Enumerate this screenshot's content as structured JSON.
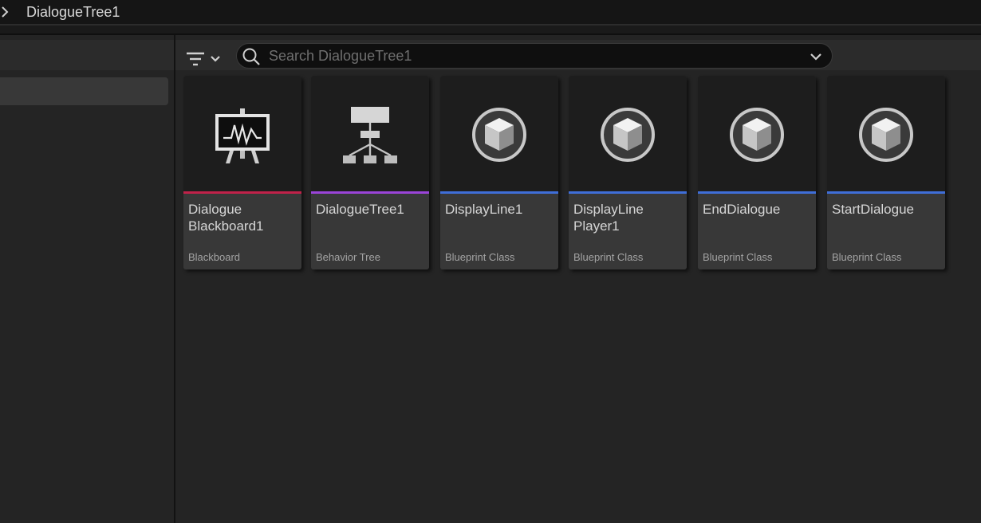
{
  "breadcrumb": {
    "path": "DialogueTree1"
  },
  "search": {
    "placeholder": "Search DialogueTree1"
  },
  "colors": {
    "blackboard": "#c0224a",
    "behavior_tree": "#9a44d8",
    "blueprint": "#3f6ed8"
  },
  "assets": [
    {
      "name": "Dialogue Blackboard1",
      "line1": "Dialogue",
      "line2": "Blackboard1",
      "type": "Blackboard",
      "icon": "blackboard-icon",
      "color": "#c0224a"
    },
    {
      "name": "DialogueTree1",
      "line1": "DialogueTree1",
      "line2": "",
      "type": "Behavior Tree",
      "icon": "behavior-tree-icon",
      "color": "#9a44d8"
    },
    {
      "name": "DisplayLine1",
      "line1": "DisplayLine1",
      "line2": "",
      "type": "Blueprint Class",
      "icon": "blueprint-cube-icon",
      "color": "#3f6ed8"
    },
    {
      "name": "DisplayLine Player1",
      "line1": "DisplayLine",
      "line2": "Player1",
      "type": "Blueprint Class",
      "icon": "blueprint-cube-icon",
      "color": "#3f6ed8"
    },
    {
      "name": "EndDialogue",
      "line1": "EndDialogue",
      "line2": "",
      "type": "Blueprint Class",
      "icon": "blueprint-cube-icon",
      "color": "#3f6ed8"
    },
    {
      "name": "StartDialogue",
      "line1": "StartDialogue",
      "line2": "",
      "type": "Blueprint Class",
      "icon": "blueprint-cube-icon",
      "color": "#3f6ed8"
    }
  ]
}
